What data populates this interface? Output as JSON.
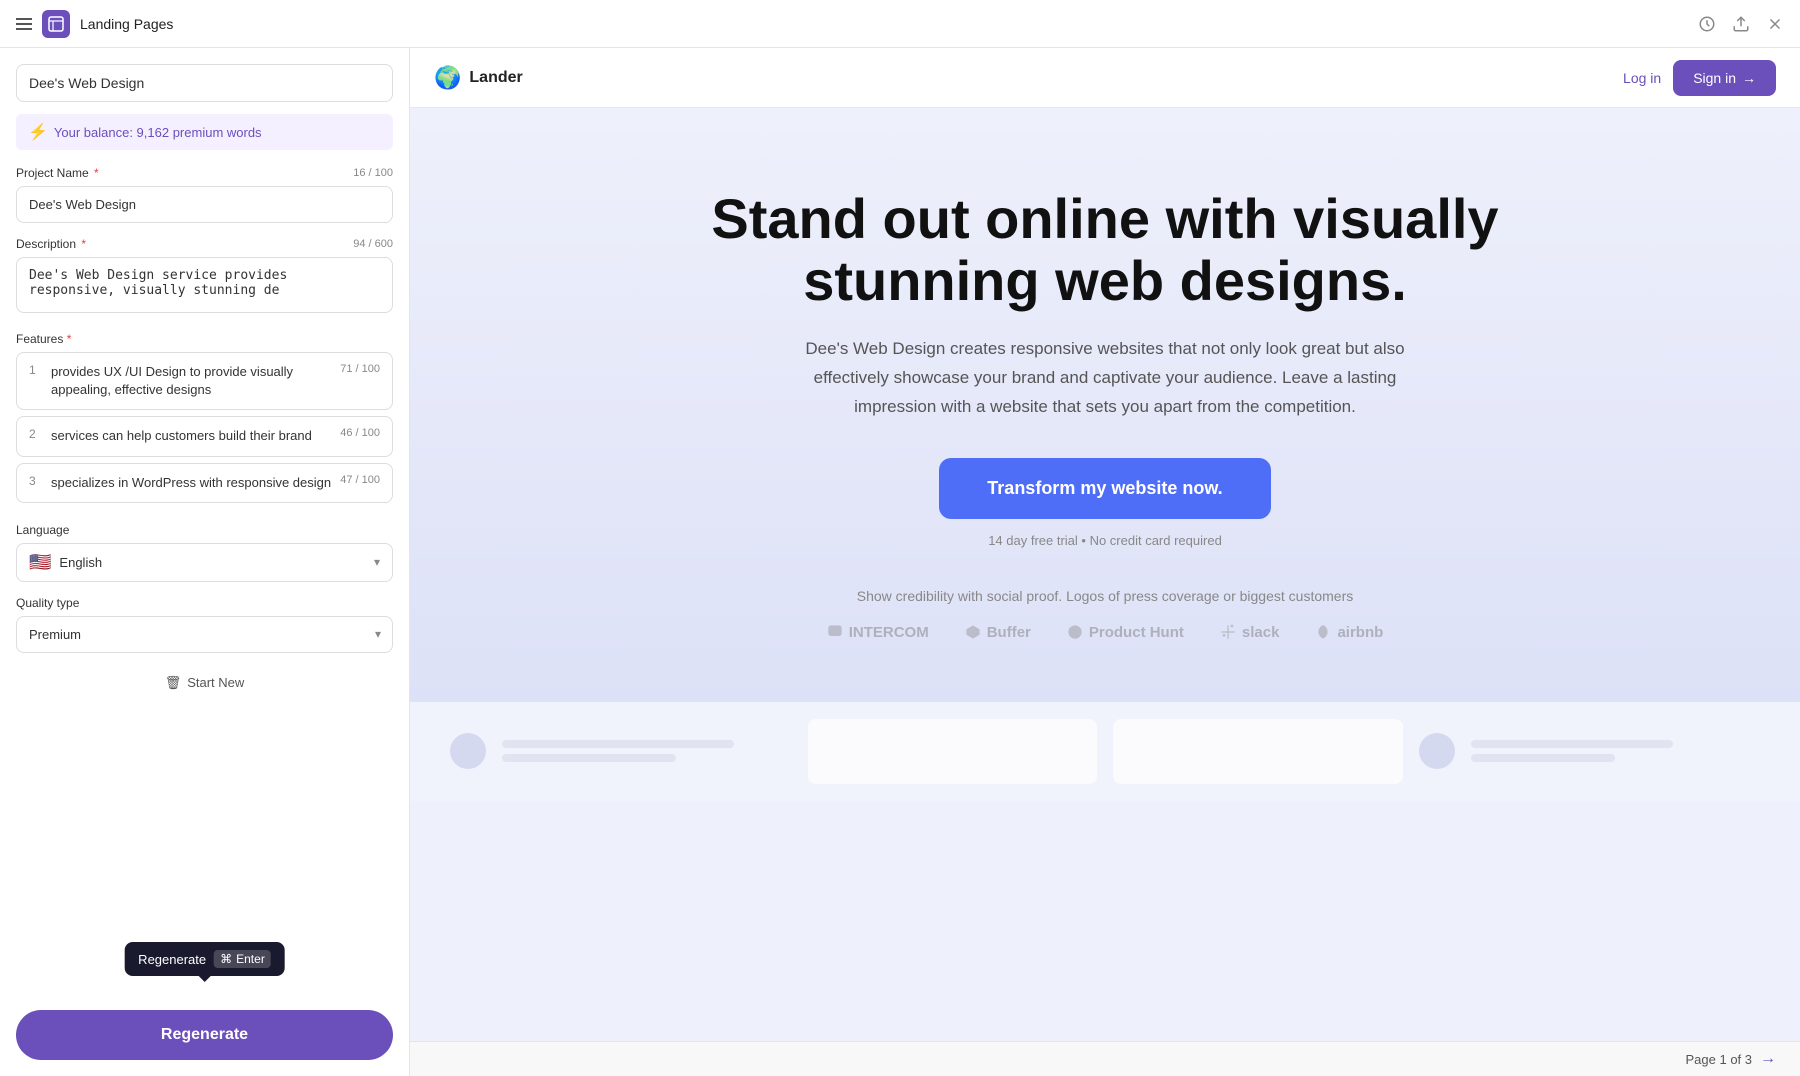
{
  "titlebar": {
    "title": "Landing Pages",
    "icon": "📄"
  },
  "left_panel": {
    "project_name_display": "Dee's Web Design",
    "balance": {
      "label": "Your balance: 9,162 premium words",
      "icon": "⚡"
    },
    "project_name_field": {
      "label": "Project Name",
      "required": true,
      "counter": "16 / 100",
      "value": "Dee's Web Design"
    },
    "description_field": {
      "label": "Description",
      "required": true,
      "counter": "94 / 600",
      "value": "Dee's Web Design service provides responsive, visually stunning de"
    },
    "features_label": "Features",
    "features_required": true,
    "features": [
      {
        "num": "1",
        "text": "provides UX /UI Design to provide visually appealing, effective designs",
        "counter": "71 / 100"
      },
      {
        "num": "2",
        "text": "services can help customers build their brand",
        "counter": "46 / 100"
      },
      {
        "num": "3",
        "text": "specializes in WordPress with responsive design",
        "counter": "47 / 100"
      }
    ],
    "language": {
      "label": "Language",
      "value": "English",
      "flag": "🇺🇸"
    },
    "quality_type": {
      "label": "Quality type",
      "value": "Premium"
    },
    "start_new_label": "Start New",
    "regenerate_label": "Regenerate"
  },
  "tooltip": {
    "label": "Regenerate",
    "shortcut_icon": "⌘",
    "shortcut_key": "Enter"
  },
  "preview": {
    "brand": "Lander",
    "login_label": "Log in",
    "signin_label": "Sign in",
    "hero_headline": "Stand out online with visually stunning web designs.",
    "hero_subtext": "Dee's Web Design creates responsive websites that not only look great but also effectively showcase your brand and captivate your audience. Leave a lasting impression with a website that sets you apart from the competition.",
    "cta_label": "Transform my website now.",
    "trial_text": "14 day free trial • No credit card required",
    "social_proof_text": "Show credibility with social proof. Logos of press coverage or biggest customers",
    "logos": [
      "INTERCOM",
      "Buffer",
      "Product Hunt",
      "slack",
      "airbnb"
    ],
    "page_indicator": "Page 1 of 3"
  }
}
